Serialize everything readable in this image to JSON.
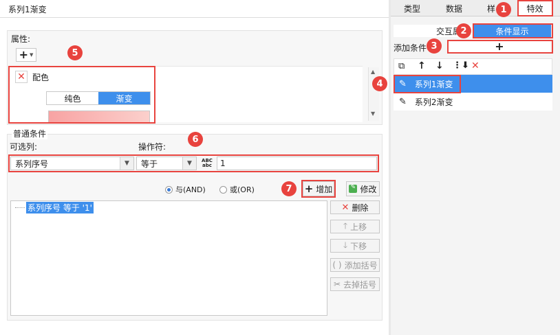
{
  "left_panel": {
    "title": "系列1渐变",
    "attributes_label": "属性:",
    "add_button": "+",
    "color_section": {
      "label": "配色",
      "tabs": [
        "纯色",
        "渐变"
      ],
      "active_tab": "渐变",
      "gradient_from": "#f8a3a3",
      "gradient_to": "#fbd0cc"
    },
    "common_conditions_label": "普通条件",
    "column_label": "可选列:",
    "operator_label": "操作符:",
    "column_value": "系列序号",
    "operator_value": "等于",
    "value_input": "1",
    "and_label": "与(AND)",
    "or_label": "或(OR)",
    "logic_selected": "and",
    "add_label": "增加",
    "modify_label": "修改",
    "condition_list": [
      "系列序号 等于 '1'"
    ],
    "side_buttons": {
      "delete": "删除",
      "up": "上移",
      "down": "下移",
      "add_bracket": "添加括号",
      "remove_bracket": "去掉括号"
    }
  },
  "right_panel": {
    "tabs": [
      "类型",
      "数据",
      "样式",
      "特效"
    ],
    "tab_style_partial": "样",
    "active_tab": "特效",
    "interaction_label": "交互属性",
    "condition_display_label": "条件显示",
    "add_condition_label": "添加条件",
    "add_condition_button": "+",
    "list": [
      {
        "label": "系列1渐变",
        "selected": true
      },
      {
        "label": "系列2渐变",
        "selected": false
      }
    ]
  },
  "callouts": [
    "1",
    "2",
    "3",
    "4",
    "5",
    "6",
    "7"
  ],
  "colors": {
    "accent": "#3e8fec",
    "callout": "#e8433e",
    "selected_row": "#3e8fec"
  }
}
